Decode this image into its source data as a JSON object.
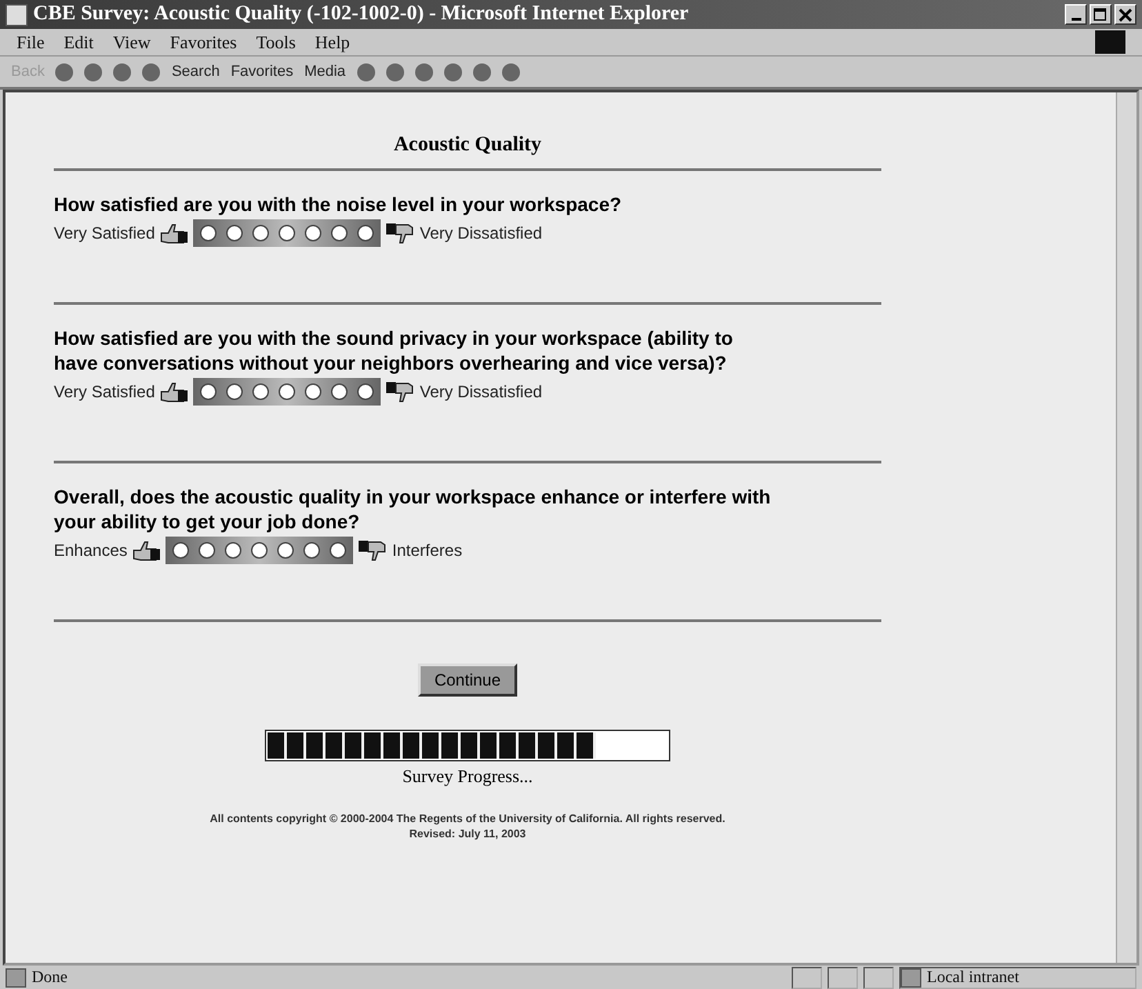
{
  "window": {
    "title": "CBE Survey: Acoustic Quality (-102-1002-0) - Microsoft Internet Explorer"
  },
  "menu": [
    "File",
    "Edit",
    "View",
    "Favorites",
    "Tools",
    "Help"
  ],
  "toolbar": [
    {
      "label": "Back",
      "disabled": true
    },
    {
      "label": "Search",
      "disabled": false
    },
    {
      "label": "Favorites",
      "disabled": false
    },
    {
      "label": "Media",
      "disabled": false
    }
  ],
  "page": {
    "heading": "Acoustic Quality",
    "questions": [
      {
        "text": "How satisfied are you with the noise level in your workspace?",
        "low_label": "Very Satisfied",
        "high_label": "Very Dissatisfied",
        "options": [
          {
            "selected": false
          },
          {
            "selected": false
          },
          {
            "selected": false
          },
          {
            "selected": false
          },
          {
            "selected": false
          },
          {
            "selected": false
          },
          {
            "selected": false
          }
        ]
      },
      {
        "text": "How satisfied are you with the sound privacy in your workspace (ability to have conversations without your neighbors overhearing and vice versa)?",
        "low_label": "Very Satisfied",
        "high_label": "Very Dissatisfied",
        "options": [
          {
            "selected": false
          },
          {
            "selected": false
          },
          {
            "selected": false
          },
          {
            "selected": false
          },
          {
            "selected": false
          },
          {
            "selected": false
          },
          {
            "selected": false
          }
        ]
      },
      {
        "text": "Overall, does the acoustic quality in your workspace enhance or interfere with your ability to get your job done?",
        "low_label": "Enhances",
        "high_label": "Interferes",
        "options": [
          {
            "selected": false
          },
          {
            "selected": false
          },
          {
            "selected": false
          },
          {
            "selected": false
          },
          {
            "selected": false
          },
          {
            "selected": false
          },
          {
            "selected": false
          }
        ]
      }
    ],
    "continue_button": "Continue",
    "progress": {
      "level": 0.82,
      "label": "Survey Progress..."
    },
    "footer": [
      "All contents copyright © 2000-2004 The Regents of the University of California. All rights reserved.",
      "Revised: July 11, 2003"
    ]
  },
  "status_bar": {
    "status": "Done",
    "zone": "Local intranet"
  }
}
